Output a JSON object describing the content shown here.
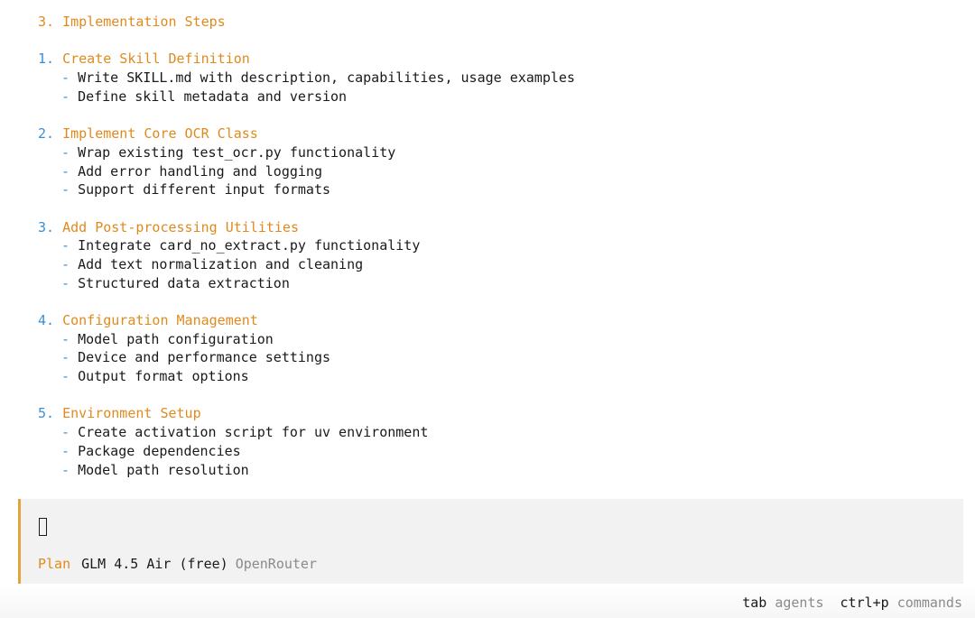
{
  "document": {
    "heading": "3. Implementation Steps",
    "sections": [
      {
        "number": "1.",
        "title": "Create Skill Definition",
        "bullets": [
          "Write SKILL.md with description, capabilities, usage examples",
          "Define skill metadata and version"
        ]
      },
      {
        "number": "2.",
        "title": "Implement Core OCR Class",
        "bullets": [
          "Wrap existing test_ocr.py functionality",
          "Add error handling and logging",
          "Support different input formats"
        ]
      },
      {
        "number": "3.",
        "title": "Add Post-processing Utilities",
        "bullets": [
          "Integrate card_no_extract.py functionality",
          "Add text normalization and cleaning",
          "Structured data extraction"
        ]
      },
      {
        "number": "4.",
        "title": "Configuration Management",
        "bullets": [
          "Model path configuration",
          "Device and performance settings",
          "Output format options"
        ]
      },
      {
        "number": "5.",
        "title": "Environment Setup",
        "bullets": [
          "Create activation script for uv environment",
          "Package dependencies",
          "Model path resolution"
        ]
      }
    ]
  },
  "input": {
    "cursor_glyph": "",
    "mode": "Plan",
    "model": "GLM 4.5 Air (free)",
    "provider": "OpenRouter"
  },
  "footer": {
    "hints": [
      {
        "key": "tab",
        "label": "agents"
      },
      {
        "key": "ctrl+p",
        "label": "commands"
      }
    ]
  },
  "colors": {
    "accent_orange": "#e08a1e",
    "list_blue": "#3a8fd6",
    "panel_bg": "#f2f2f2",
    "panel_border": "#e6a23c",
    "muted_text": "#8a8a8a"
  }
}
